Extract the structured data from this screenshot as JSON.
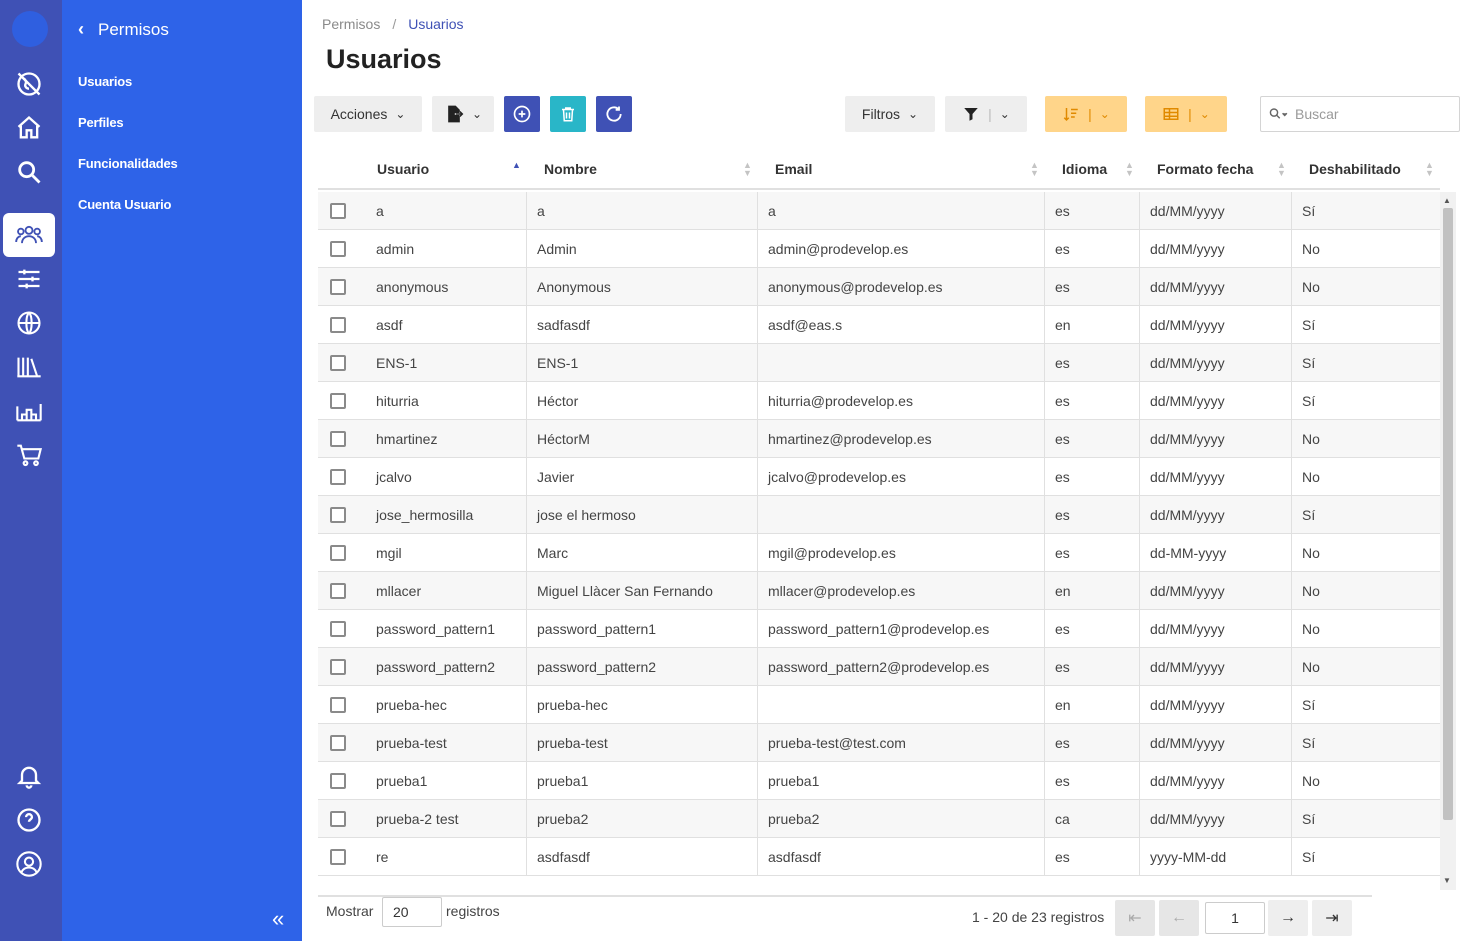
{
  "breadcrumb": {
    "parent": "Permisos",
    "separator": "/",
    "current": "Usuarios"
  },
  "page_title": "Usuarios",
  "side_menu": {
    "title": "Permisos",
    "items": [
      "Usuarios",
      "Perfiles",
      "Funcionalidades",
      "Cuenta Usuario"
    ],
    "collapse_icon": "double-chevron-left-icon"
  },
  "rail_icons": [
    "world-off-icon",
    "home-icon",
    "search-icon",
    "users-icon",
    "sliders-icon",
    "globe-icon",
    "library-icon",
    "warehouse-icon",
    "cart-icon",
    "bell-icon",
    "help-icon",
    "user-circle-icon"
  ],
  "toolbar": {
    "actions_label": "Acciones",
    "filters_label": "Filtros",
    "search_placeholder": "Buscar"
  },
  "colors": {
    "rail": "#3f51b5",
    "menu": "#2e63e8",
    "accent": "#3f51b5",
    "delete": "#29b6c8",
    "orange": "#ffd58a"
  },
  "table": {
    "columns": [
      "Usuario",
      "Nombre",
      "Email",
      "Idioma",
      "Formato fecha",
      "Deshabilitado"
    ],
    "rows": [
      [
        "a",
        "a",
        "a",
        "es",
        "dd/MM/yyyy",
        "Sí"
      ],
      [
        "admin",
        "Admin",
        "admin@prodevelop.es",
        "es",
        "dd/MM/yyyy",
        "No"
      ],
      [
        "anonymous",
        "Anonymous",
        "anonymous@prodevelop.es",
        "es",
        "dd/MM/yyyy",
        "No"
      ],
      [
        "asdf",
        "sadfasdf",
        "asdf@eas.s",
        "en",
        "dd/MM/yyyy",
        "Sí"
      ],
      [
        "ENS-1",
        "ENS-1",
        "",
        "es",
        "dd/MM/yyyy",
        "Sí"
      ],
      [
        "hiturria",
        "Héctor",
        "hiturria@prodevelop.es",
        "es",
        "dd/MM/yyyy",
        "Sí"
      ],
      [
        "hmartinez",
        "HéctorM",
        "hmartinez@prodevelop.es",
        "es",
        "dd/MM/yyyy",
        "No"
      ],
      [
        "jcalvo",
        "Javier",
        "jcalvo@prodevelop.es",
        "es",
        "dd/MM/yyyy",
        "No"
      ],
      [
        "jose_hermosilla",
        "jose el hermoso",
        "",
        "es",
        "dd/MM/yyyy",
        "Sí"
      ],
      [
        "mgil",
        "Marc",
        "mgil@prodevelop.es",
        "es",
        "dd-MM-yyyy",
        "No"
      ],
      [
        "mllacer",
        "Miguel Llàcer San Fernando",
        "mllacer@prodevelop.es",
        "en",
        "dd/MM/yyyy",
        "No"
      ],
      [
        "password_pattern1",
        "password_pattern1",
        "password_pattern1@prodevelop.es",
        "es",
        "dd/MM/yyyy",
        "No"
      ],
      [
        "password_pattern2",
        "password_pattern2",
        "password_pattern2@prodevelop.es",
        "es",
        "dd/MM/yyyy",
        "No"
      ],
      [
        "prueba-hec",
        "prueba-hec",
        "",
        "en",
        "dd/MM/yyyy",
        "Sí"
      ],
      [
        "prueba-test",
        "prueba-test",
        "prueba-test@test.com",
        "es",
        "dd/MM/yyyy",
        "Sí"
      ],
      [
        "prueba1",
        "prueba1",
        "prueba1",
        "es",
        "dd/MM/yyyy",
        "No"
      ],
      [
        "prueba-2 test",
        "prueba2",
        "prueba2",
        "ca",
        "dd/MM/yyyy",
        "Sí"
      ],
      [
        "re",
        "asdfasdf",
        "asdfasdf",
        "es",
        "yyyy-MM-dd",
        "Sí"
      ]
    ]
  },
  "pagination": {
    "show_label": "Mostrar",
    "per_page": "20",
    "records_label": "registros",
    "summary": "1 - 20 de 23 registros",
    "current_page": "1"
  }
}
